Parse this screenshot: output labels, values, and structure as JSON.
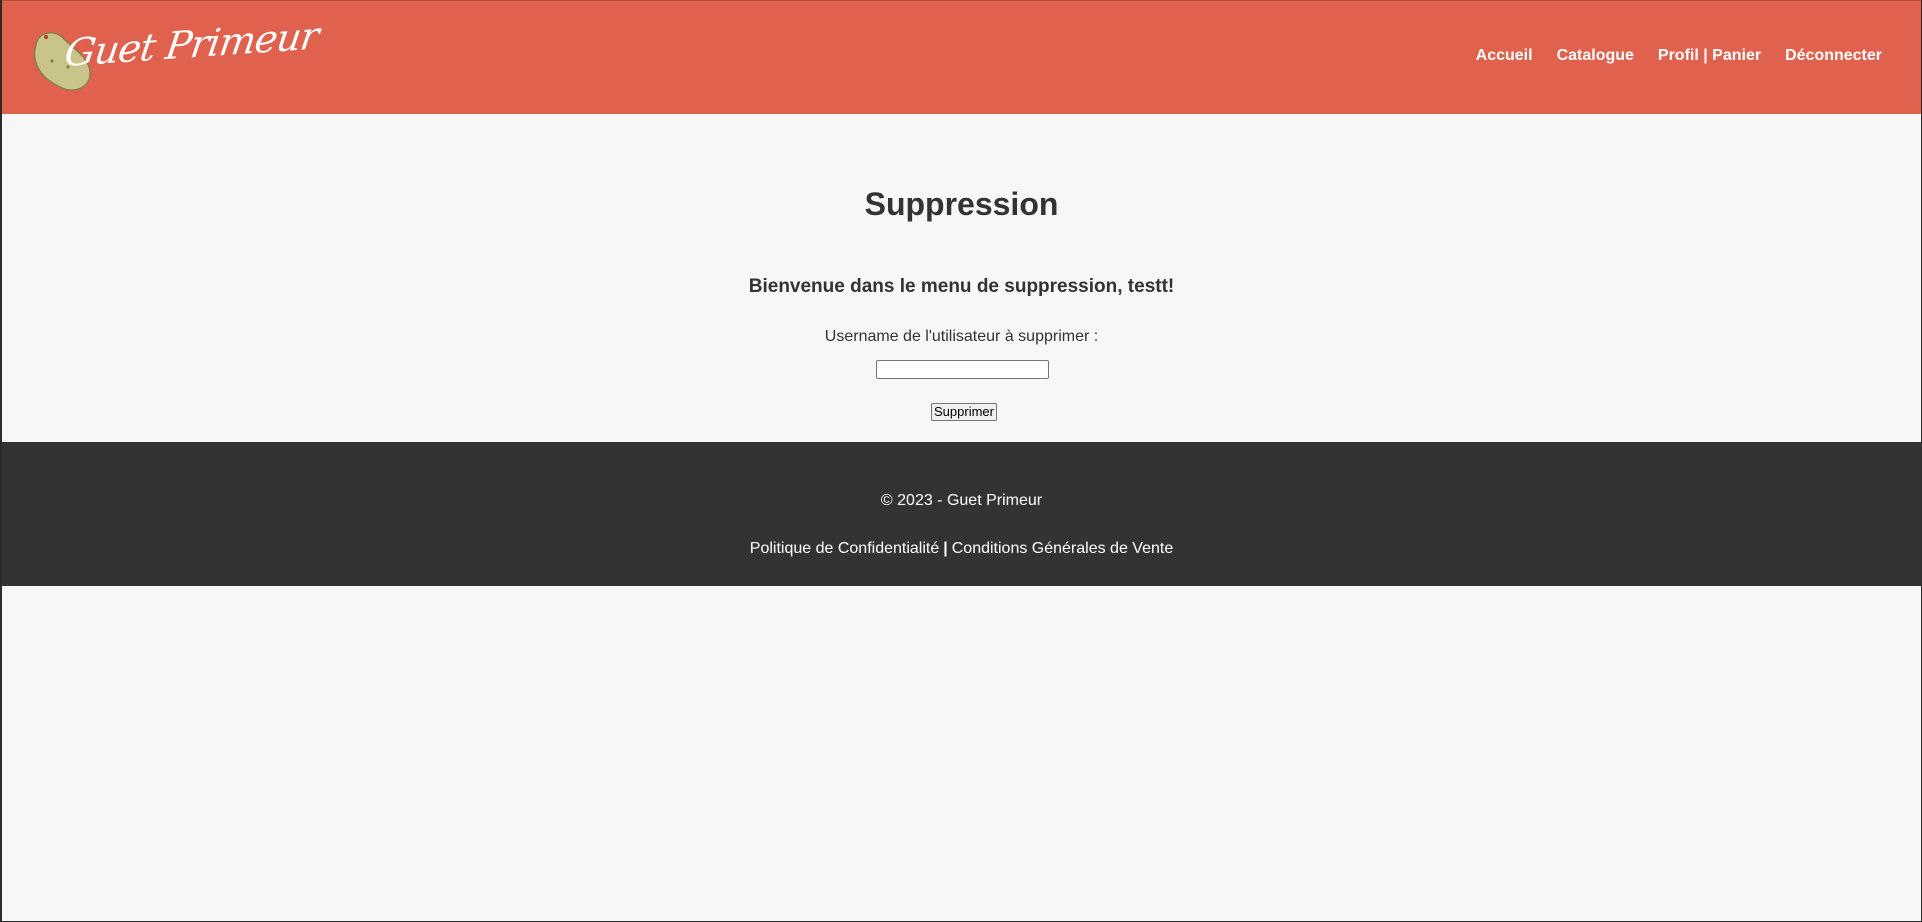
{
  "header": {
    "logo_text": "Guet Primeur",
    "nav": [
      {
        "label": "Accueil"
      },
      {
        "label": "Catalogue"
      },
      {
        "label": "Profil | Panier"
      },
      {
        "label": "Déconnecter"
      }
    ]
  },
  "main": {
    "title": "Suppression",
    "welcome": "Bienvenue dans le menu de suppression, testt!",
    "field_label": "Username de l'utilisateur à supprimer :",
    "username_value": "",
    "submit_label": "Supprimer"
  },
  "footer": {
    "copyright": "© 2023 - Guet Primeur",
    "privacy_label": "Politique de Confidentialité",
    "separator": "|",
    "terms_label": "Conditions Générales de Vente"
  },
  "colors": {
    "header_bg": "#e0614d",
    "footer_bg": "#333333",
    "page_bg": "#f7f7f7",
    "logo_potato": "#c9c48a"
  }
}
